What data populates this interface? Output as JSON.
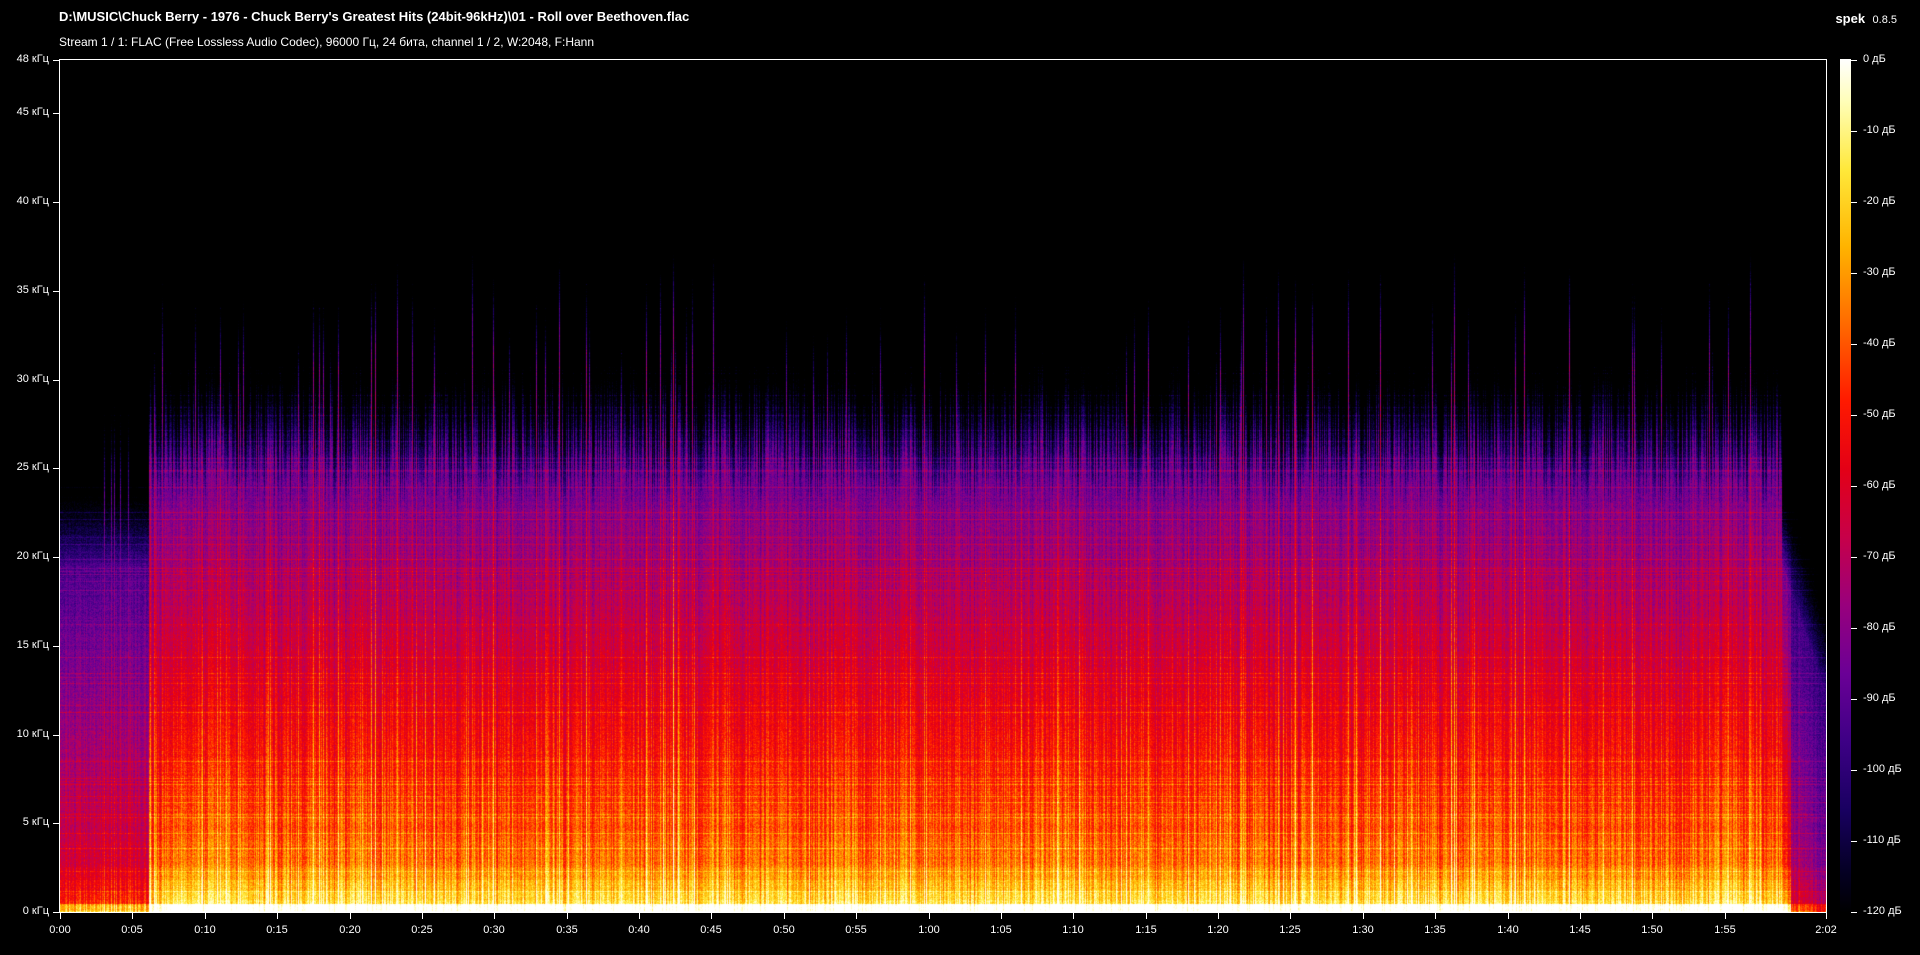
{
  "header": {
    "file_path": "D:\\MUSIC\\Chuck Berry - 1976 - Chuck Berry's Greatest Hits (24bit-96kHz)\\01 - Roll over Beethoven.flac",
    "stream_info": "Stream 1 / 1: FLAC (Free Lossless Audio Codec), 96000 Гц, 24 бита, channel 1 / 2, W:2048, F:Hann",
    "app_name": "spek",
    "app_version": "0.8.5"
  },
  "freq_axis": {
    "ticks": [
      {
        "label": "48 кГц",
        "khz": 48
      },
      {
        "label": "45 кГц",
        "khz": 45
      },
      {
        "label": "40 кГц",
        "khz": 40
      },
      {
        "label": "35 кГц",
        "khz": 35
      },
      {
        "label": "30 кГц",
        "khz": 30
      },
      {
        "label": "25 кГц",
        "khz": 25
      },
      {
        "label": "20 кГц",
        "khz": 20
      },
      {
        "label": "15 кГц",
        "khz": 15
      },
      {
        "label": "10 кГц",
        "khz": 10
      },
      {
        "label": "5 кГц",
        "khz": 5
      },
      {
        "label": "0 кГц",
        "khz": 0
      }
    ],
    "max_khz": 48
  },
  "time_axis": {
    "duration_seconds": 122,
    "ticks": [
      {
        "label": "0:00",
        "seconds": 0
      },
      {
        "label": "0:05",
        "seconds": 5
      },
      {
        "label": "0:10",
        "seconds": 10
      },
      {
        "label": "0:15",
        "seconds": 15
      },
      {
        "label": "0:20",
        "seconds": 20
      },
      {
        "label": "0:25",
        "seconds": 25
      },
      {
        "label": "0:30",
        "seconds": 30
      },
      {
        "label": "0:35",
        "seconds": 35
      },
      {
        "label": "0:40",
        "seconds": 40
      },
      {
        "label": "0:45",
        "seconds": 45
      },
      {
        "label": "0:50",
        "seconds": 50
      },
      {
        "label": "0:55",
        "seconds": 55
      },
      {
        "label": "1:00",
        "seconds": 60
      },
      {
        "label": "1:05",
        "seconds": 65
      },
      {
        "label": "1:10",
        "seconds": 70
      },
      {
        "label": "1:15",
        "seconds": 75
      },
      {
        "label": "1:20",
        "seconds": 80
      },
      {
        "label": "1:25",
        "seconds": 85
      },
      {
        "label": "1:30",
        "seconds": 90
      },
      {
        "label": "1:35",
        "seconds": 95
      },
      {
        "label": "1:40",
        "seconds": 100
      },
      {
        "label": "1:45",
        "seconds": 105
      },
      {
        "label": "1:50",
        "seconds": 110
      },
      {
        "label": "1:55",
        "seconds": 115
      },
      {
        "label": "2:02",
        "seconds": 122
      }
    ]
  },
  "db_scale": {
    "ticks": [
      {
        "label": "0 дБ",
        "db": 0
      },
      {
        "label": "-10 дБ",
        "db": -10
      },
      {
        "label": "-20 дБ",
        "db": -20
      },
      {
        "label": "-30 дБ",
        "db": -30
      },
      {
        "label": "-40 дБ",
        "db": -40
      },
      {
        "label": "-50 дБ",
        "db": -50
      },
      {
        "label": "-60 дБ",
        "db": -60
      },
      {
        "label": "-70 дБ",
        "db": -70
      },
      {
        "label": "-80 дБ",
        "db": -80
      },
      {
        "label": "-90 дБ",
        "db": -90
      },
      {
        "label": "-100 дБ",
        "db": -100
      },
      {
        "label": "-110 дБ",
        "db": -110
      },
      {
        "label": "-120 дБ",
        "db": -120
      }
    ],
    "min_db": -120,
    "max_db": 0
  },
  "colors": {
    "background": "#000000",
    "text": "#ffffff",
    "palette": [
      "#000000",
      "#050025",
      "#180060",
      "#3d0085",
      "#6a0096",
      "#98007d",
      "#c70049",
      "#e30016",
      "#ff1a00",
      "#ff6a00",
      "#ffb300",
      "#ffe83a",
      "#fffeb8",
      "#ffffff"
    ]
  }
}
